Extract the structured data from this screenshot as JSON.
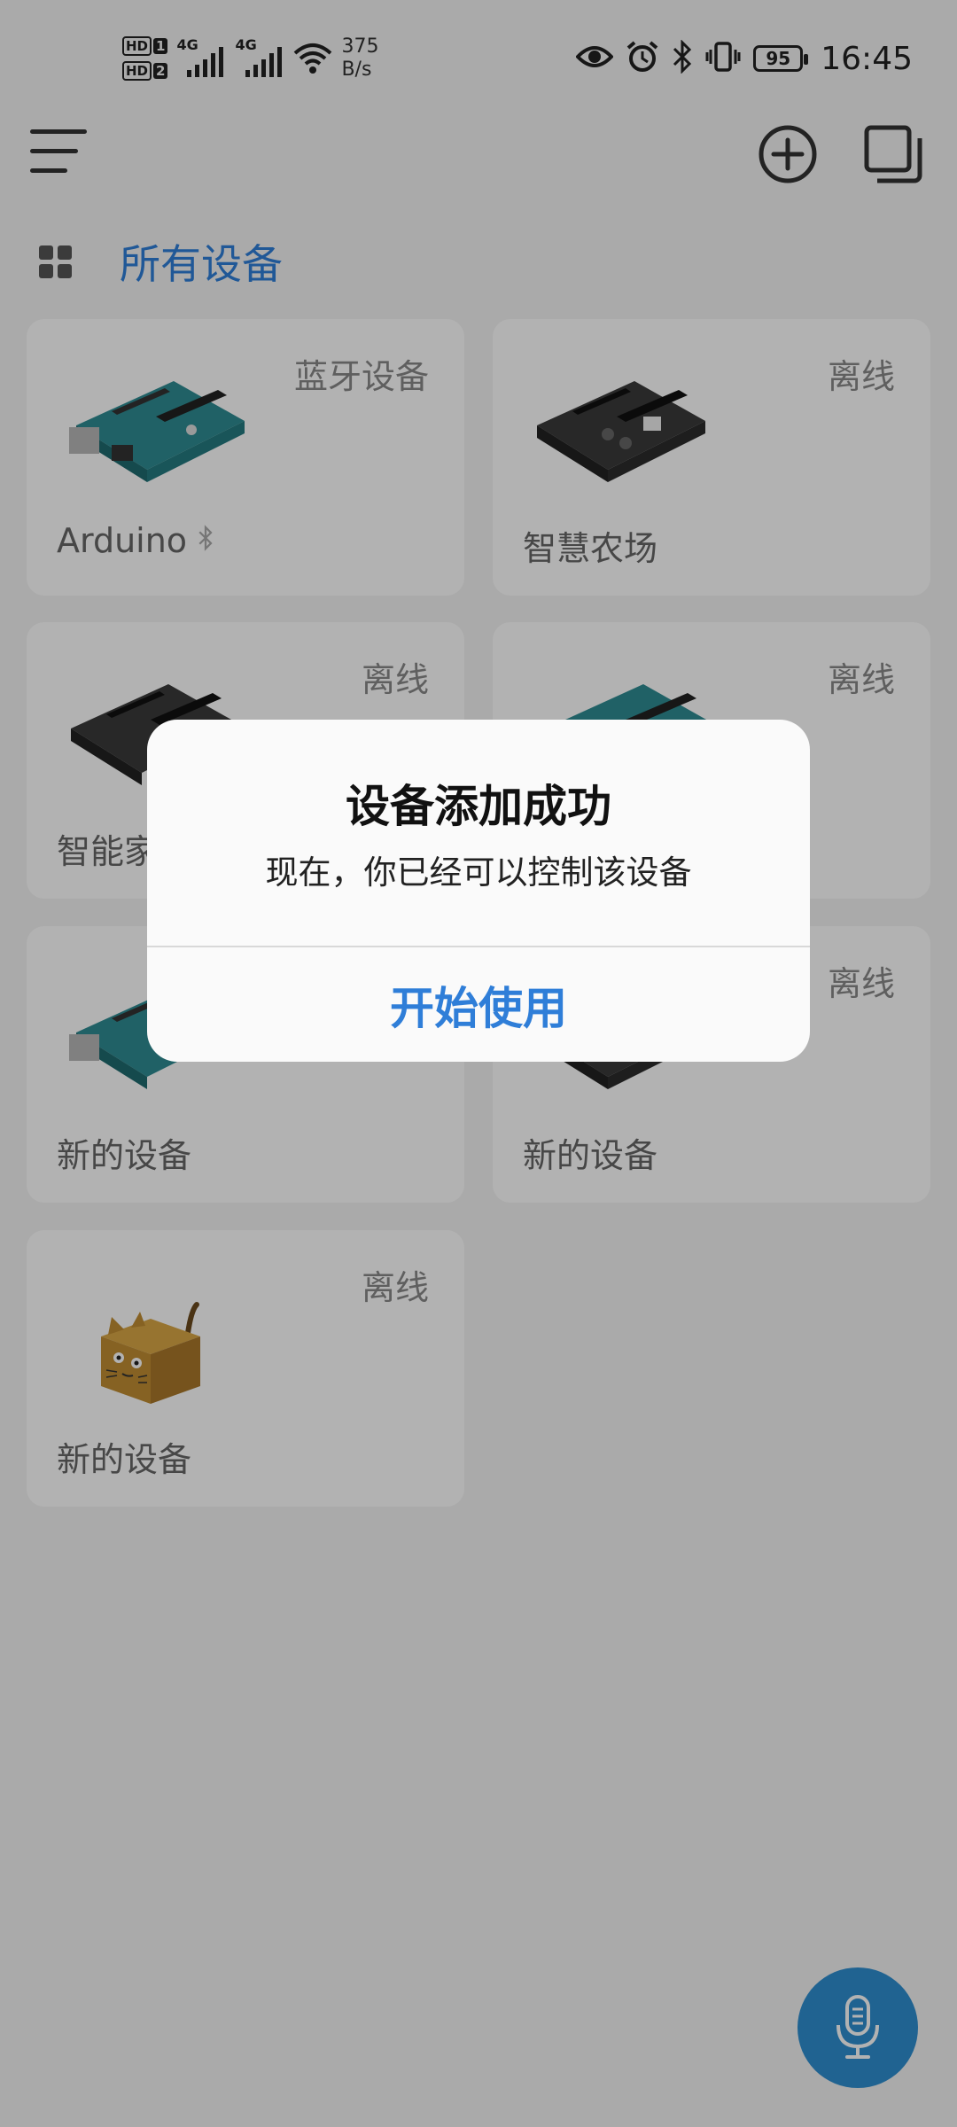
{
  "status_bar": {
    "sim1": "1",
    "sim2": "2",
    "hd_label": "HD",
    "network_type": "4G",
    "net_speed_value": "375",
    "net_speed_unit": "B/s",
    "battery": "95",
    "time": "16:45"
  },
  "header": {
    "section_title": "所有设备"
  },
  "devices": [
    {
      "name": "Arduino",
      "status": "蓝牙设备",
      "image": "arduino-uno-teal-board",
      "bluetooth": true
    },
    {
      "name": "智慧农场",
      "status": "离线",
      "image": "wifiduino-black-board",
      "bluetooth": false
    },
    {
      "name": "智能家",
      "status": "离线",
      "image": "wifiduino-black-board",
      "bluetooth": false
    },
    {
      "name": "",
      "status": "离线",
      "image": "arduino-uno-teal-board",
      "bluetooth": false
    },
    {
      "name": "新的设备",
      "status": "",
      "image": "arduino-uno-teal-board",
      "bluetooth": false
    },
    {
      "name": "新的设备",
      "status": "离线",
      "image": "wifiduino-black-board",
      "bluetooth": false
    },
    {
      "name": "新的设备",
      "status": "离线",
      "image": "cardboard-cat-box",
      "bluetooth": false
    }
  ],
  "dialog": {
    "title": "设备添加成功",
    "message": "现在，你已经可以控制该设备",
    "action": "开始使用"
  },
  "colors": {
    "accent": "#2f7ed8",
    "voice_button": "#2f8fd0",
    "scrim": "rgba(0,0,0,0.30)"
  },
  "icons": [
    "menu-icon",
    "add-circle-icon",
    "window-copy-icon",
    "grid-icon",
    "bluetooth-icon",
    "microphone-icon"
  ]
}
